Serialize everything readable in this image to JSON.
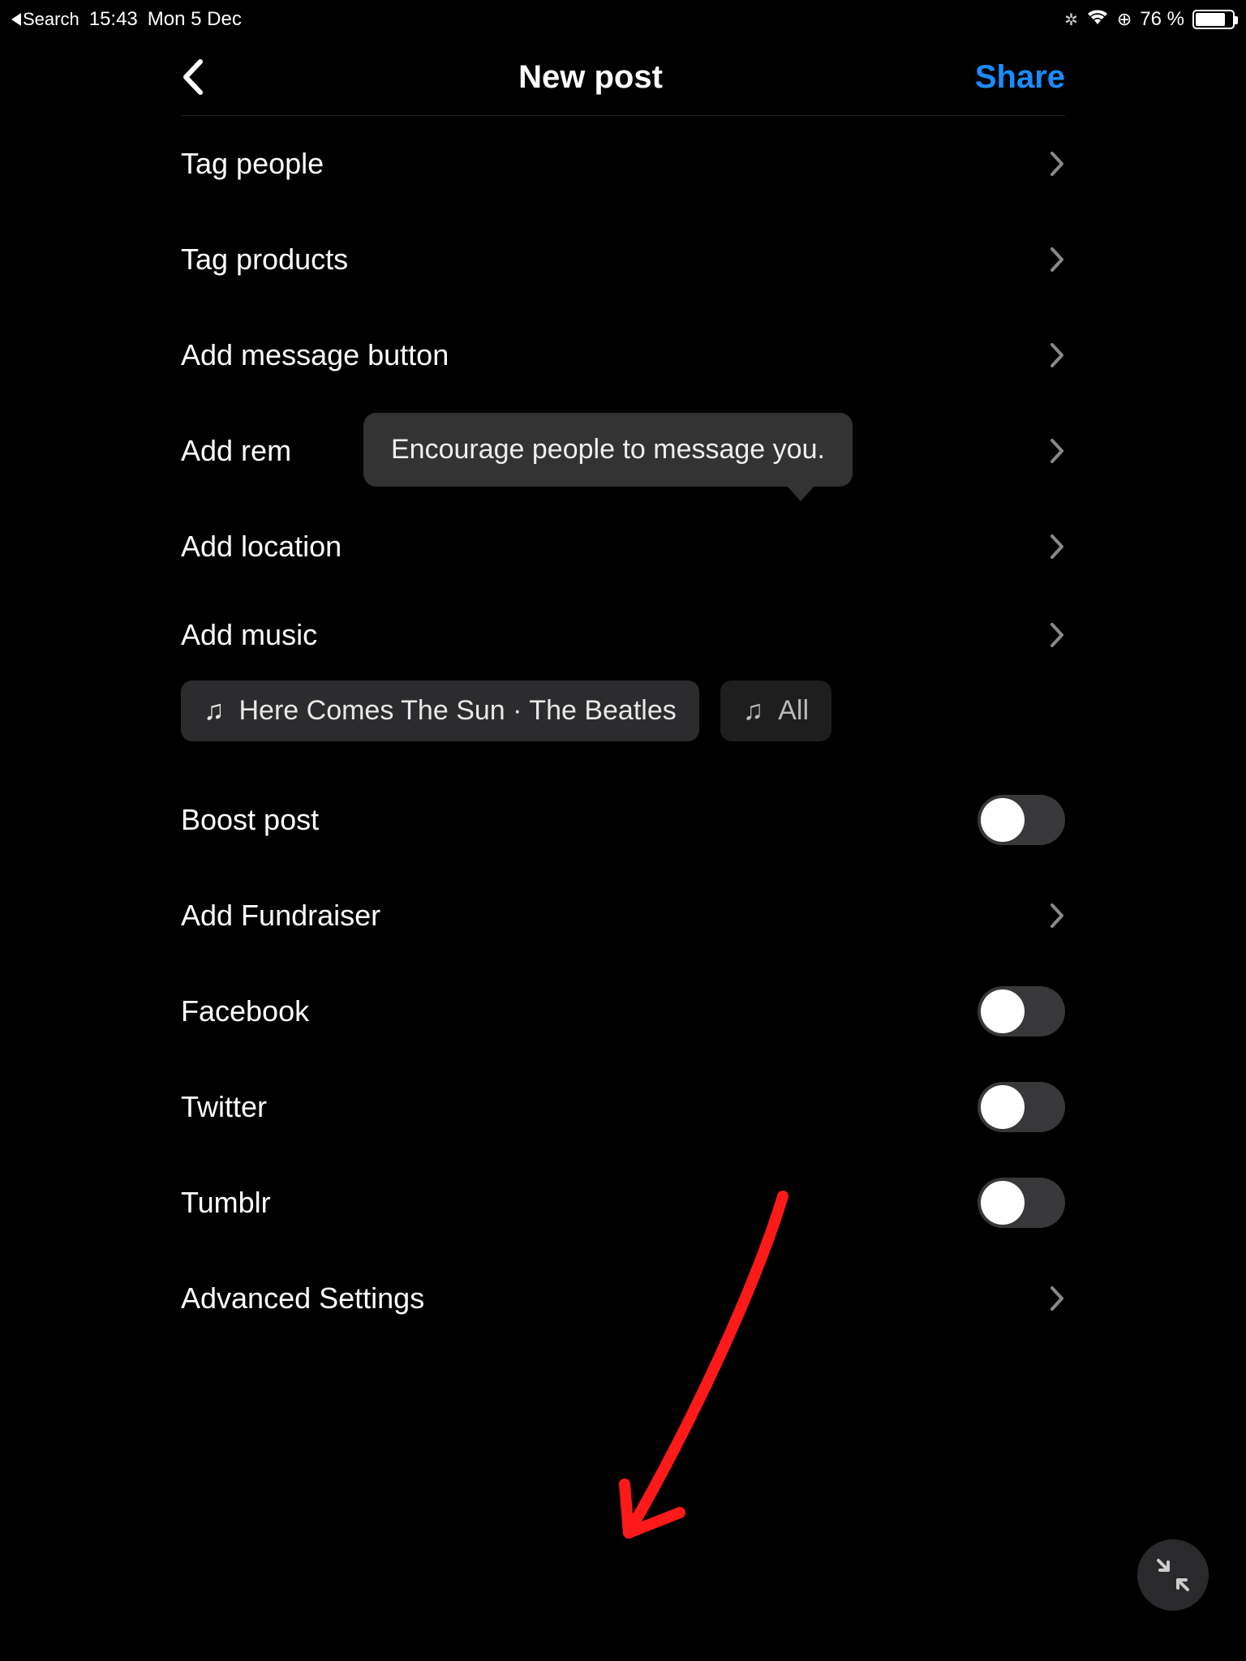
{
  "status": {
    "back_app": "Search",
    "time": "15:43",
    "date": "Mon 5 Dec",
    "battery_pct": "76 %"
  },
  "nav": {
    "title": "New post",
    "share": "Share"
  },
  "rows": {
    "tag_people": "Tag people",
    "tag_products": "Tag products",
    "add_message_button": "Add message button",
    "add_reminder": "Add rem",
    "add_location": "Add location",
    "add_music": "Add music",
    "boost_post": "Boost post",
    "add_fundraiser": "Add Fundraiser",
    "facebook": "Facebook",
    "twitter": "Twitter",
    "tumblr": "Tumblr",
    "advanced_settings": "Advanced Settings"
  },
  "tooltip": "Encourage people to message you.",
  "music": {
    "chip1": "Here Comes The Sun · The Beatles",
    "chip2": "All "
  },
  "toggles": {
    "boost_post": false,
    "facebook": false,
    "twitter": false,
    "tumblr": false
  }
}
